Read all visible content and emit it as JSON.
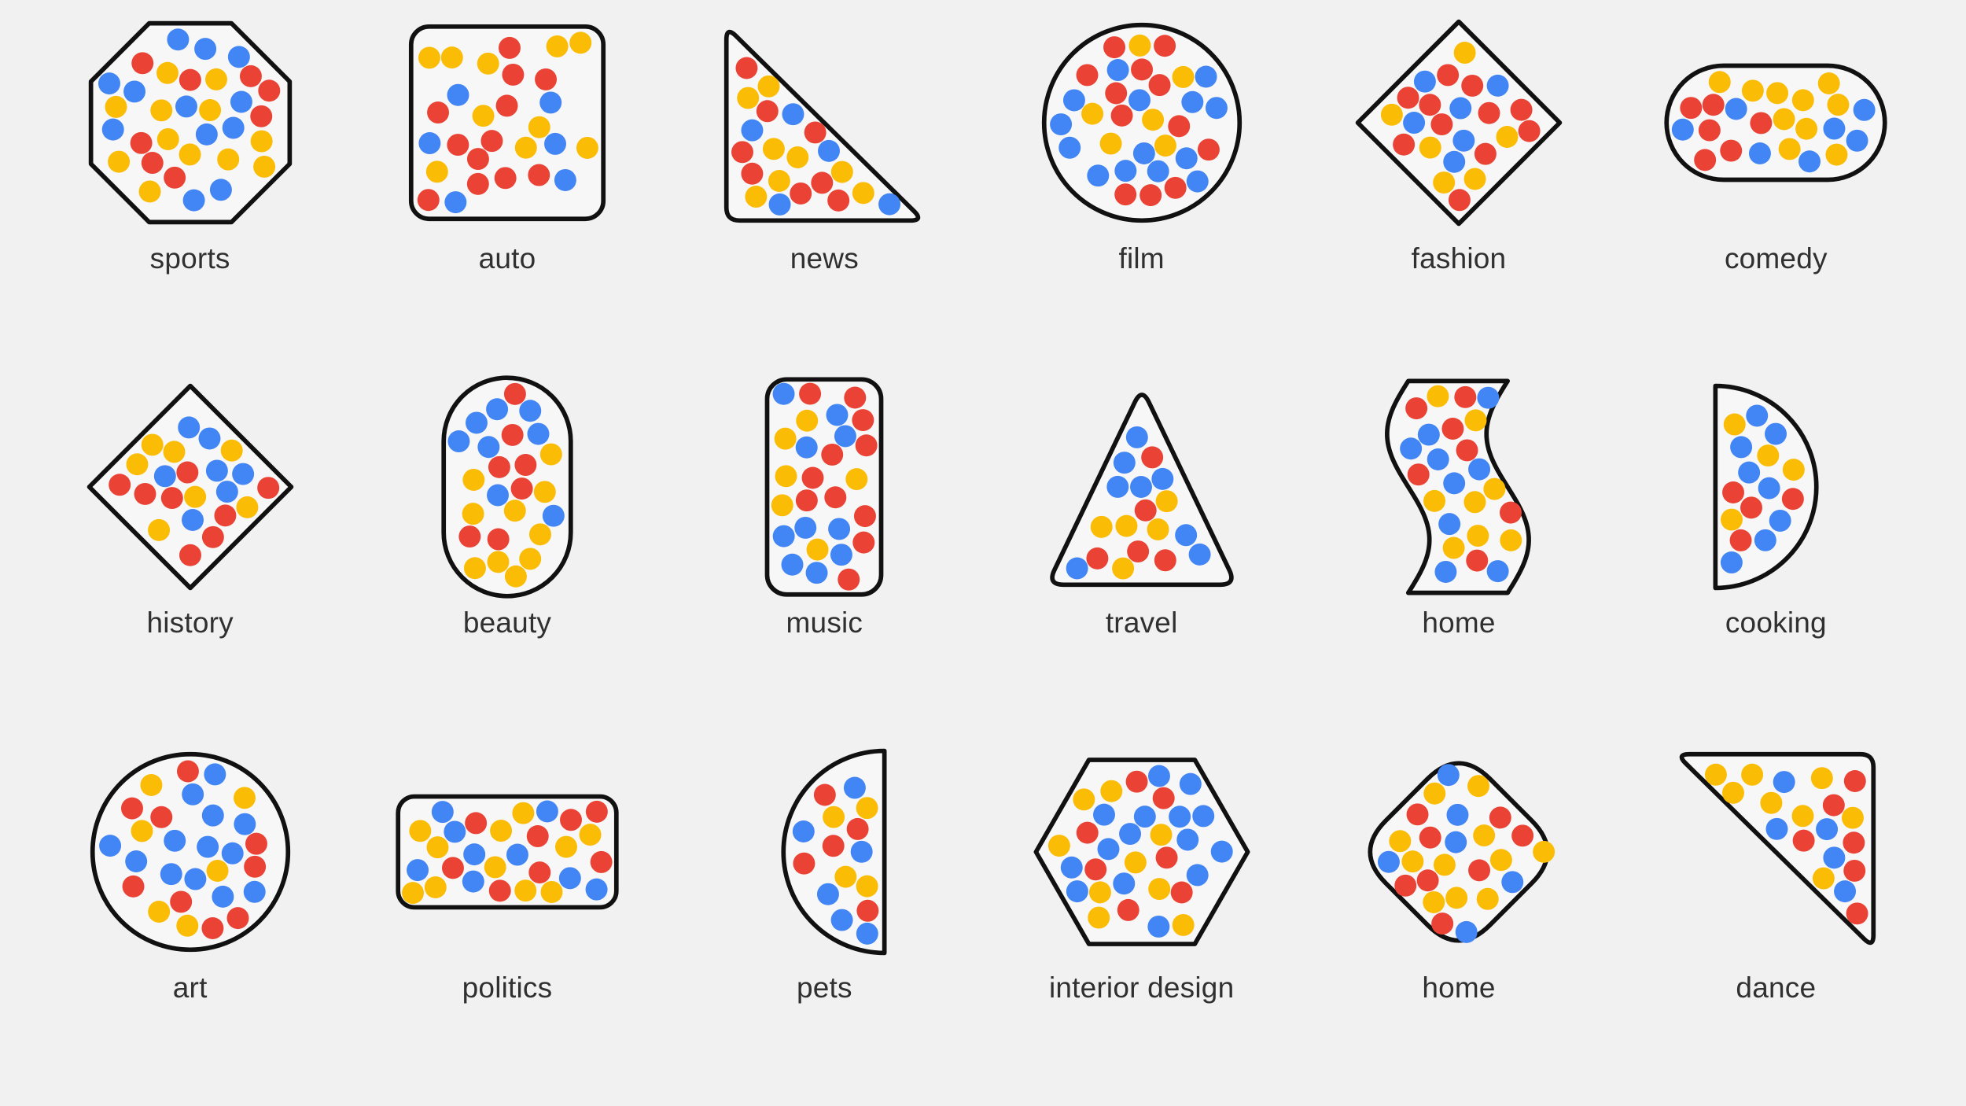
{
  "page": {
    "background_color": "#f1f1f1",
    "label_color": "#303030",
    "shape_fill": "#f7f7f7",
    "shape_stroke": "#111111"
  },
  "palette": {
    "red": "#ea4335",
    "blue": "#4285f4",
    "yellow": "#fbbc05"
  },
  "chart_data": {
    "type": "scatter",
    "title": "",
    "xlabel": "",
    "ylabel": "",
    "legend": [
      "red",
      "blue",
      "yellow"
    ],
    "description": "Grid of 18 outlined shapes, each filled with randomly scattered red / blue / yellow dots, labelled with a content category.",
    "cells": [
      {
        "label": "sports",
        "shape": "octagon",
        "dot_count": 32,
        "counts": {
          "red": 8,
          "blue": 12,
          "yellow": 12
        },
        "seed": 11
      },
      {
        "label": "auto",
        "shape": "rounded-square",
        "dot_count": 28,
        "counts": {
          "red": 12,
          "blue": 6,
          "yellow": 10
        },
        "seed": 22
      },
      {
        "label": "news",
        "shape": "triangle-right-bottom-left",
        "dot_count": 30,
        "counts": {
          "red": 11,
          "blue": 8,
          "yellow": 11
        },
        "seed": 33
      },
      {
        "label": "film",
        "shape": "circle",
        "dot_count": 32,
        "counts": {
          "red": 12,
          "blue": 14,
          "yellow": 6
        },
        "seed": 44
      },
      {
        "label": "fashion",
        "shape": "diamond",
        "dot_count": 30,
        "counts": {
          "red": 13,
          "blue": 8,
          "yellow": 9
        },
        "seed": 55
      },
      {
        "label": "comedy",
        "shape": "stadium-horizontal",
        "dot_count": 40,
        "counts": {
          "red": 14,
          "blue": 12,
          "yellow": 14
        },
        "seed": 66
      },
      {
        "label": "history",
        "shape": "diamond",
        "dot_count": 24,
        "counts": {
          "red": 9,
          "blue": 7,
          "yellow": 8
        },
        "seed": 77
      },
      {
        "label": "beauty",
        "shape": "stadium-vertical",
        "dot_count": 42,
        "counts": {
          "red": 14,
          "blue": 14,
          "yellow": 14
        },
        "seed": 88
      },
      {
        "label": "music",
        "shape": "rounded-rect-vertical",
        "dot_count": 42,
        "counts": {
          "red": 14,
          "blue": 14,
          "yellow": 14
        },
        "seed": 99
      },
      {
        "label": "travel",
        "shape": "triangle-up",
        "dot_count": 30,
        "counts": {
          "red": 7,
          "blue": 13,
          "yellow": 10
        },
        "seed": 111
      },
      {
        "label": "home",
        "shape": "wave",
        "dot_count": 38,
        "counts": {
          "red": 10,
          "blue": 14,
          "yellow": 14
        },
        "seed": 122
      },
      {
        "label": "cooking",
        "shape": "half-circle-right",
        "dot_count": 20,
        "counts": {
          "red": 5,
          "blue": 9,
          "yellow": 6
        },
        "seed": 133
      },
      {
        "label": "art",
        "shape": "circle",
        "dot_count": 28,
        "counts": {
          "red": 9,
          "blue": 13,
          "yellow": 6
        },
        "seed": 144
      },
      {
        "label": "politics",
        "shape": "rounded-rect-horizontal",
        "dot_count": 46,
        "counts": {
          "red": 17,
          "blue": 15,
          "yellow": 14
        },
        "seed": 155
      },
      {
        "label": "pets",
        "shape": "half-circle-left",
        "dot_count": 20,
        "counts": {
          "red": 5,
          "blue": 9,
          "yellow": 6
        },
        "seed": 166
      },
      {
        "label": "interior design",
        "shape": "hexagon",
        "dot_count": 36,
        "counts": {
          "red": 7,
          "blue": 18,
          "yellow": 11
        },
        "seed": 177
      },
      {
        "label": "home",
        "shape": "rounded-diamond",
        "dot_count": 38,
        "counts": {
          "red": 15,
          "blue": 11,
          "yellow": 12
        },
        "seed": 188
      },
      {
        "label": "dance",
        "shape": "triangle-right-top-right",
        "dot_count": 28,
        "counts": {
          "red": 10,
          "blue": 8,
          "yellow": 10
        },
        "seed": 199
      }
    ]
  }
}
